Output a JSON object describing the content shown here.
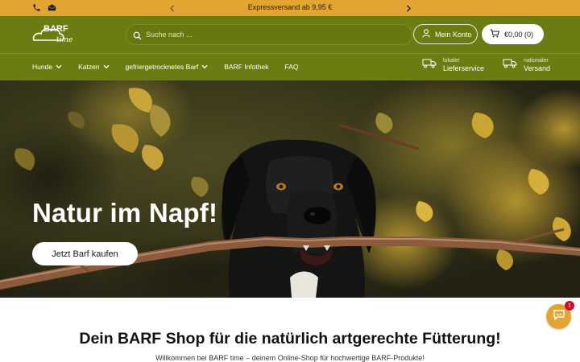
{
  "announcement": {
    "text": "Expressversand ab 9,95 €",
    "icons": [
      "phone-icon",
      "mail-icon",
      "chevron-left-icon",
      "chevron-right-icon"
    ]
  },
  "header": {
    "logo": {
      "brand": "BARF",
      "tagline": "time"
    },
    "search": {
      "placeholder": "Suche nach ..."
    },
    "account_label": "Mein Konto",
    "cart_label": "€0,00 (0)"
  },
  "nav": {
    "items": [
      {
        "label": "Hunde",
        "dropdown": true
      },
      {
        "label": "Katzen",
        "dropdown": true
      },
      {
        "label": "gefriergetrocknetes Barf",
        "dropdown": true
      },
      {
        "label": "BARF Infothek",
        "dropdown": false
      },
      {
        "label": "FAQ",
        "dropdown": false
      }
    ],
    "services": [
      {
        "small": "lokaler",
        "big": "Lieferservice",
        "icon": "delivery-truck-icon"
      },
      {
        "small": "nationaler",
        "big": "Versand",
        "icon": "delivery-truck-icon"
      }
    ]
  },
  "hero": {
    "title": "Natur im Napf!",
    "button_label": "Jetzt Barf kaufen"
  },
  "main": {
    "title": "Dein BARF Shop für die natürlich artgerechte Fütterung!",
    "subtitle": "Willkommen bei BARF time – deinem Online-Shop für hochwertige BARF-Produkte!"
  },
  "chat": {
    "badge": "1",
    "icon": "chat-icon"
  },
  "colors": {
    "accent_yellow": "#e3a531",
    "header_green": "#6b7d12",
    "white": "#ffffff"
  }
}
